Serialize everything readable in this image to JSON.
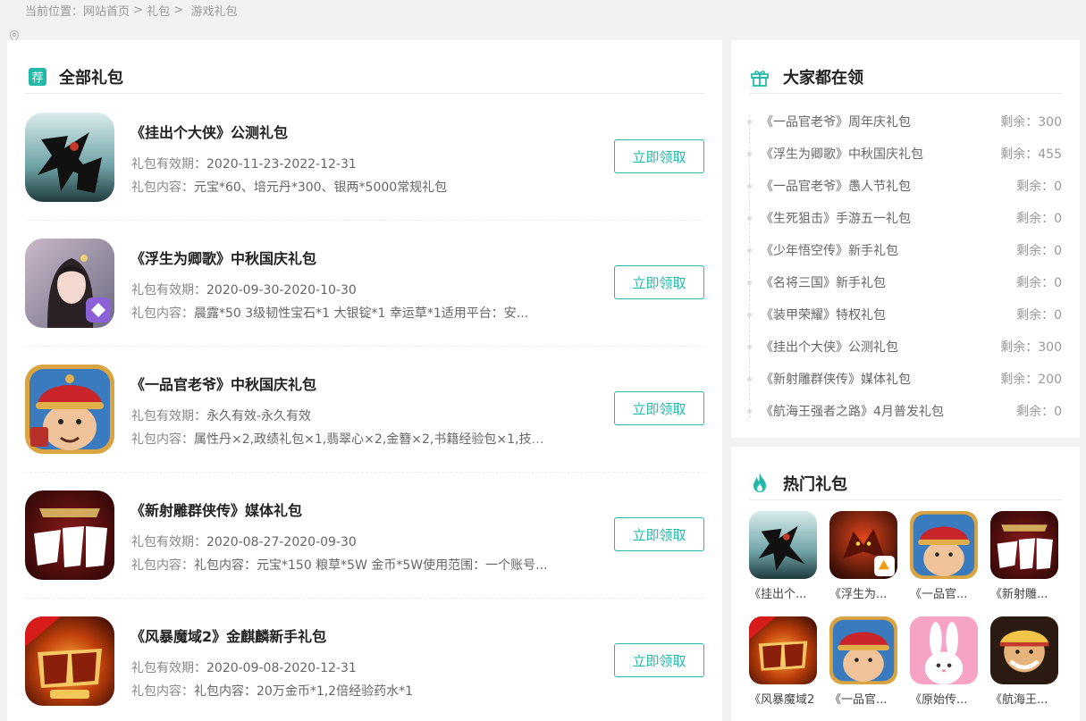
{
  "breadcrumb": {
    "prefix": "当前位置：",
    "home": "网站首页",
    "sep1": " > ",
    "gift": "礼包",
    "sep2": " >  ",
    "current": "游戏礼包"
  },
  "main": {
    "badge": "荐",
    "title": "全部礼包",
    "validity_label": "礼包有效期：",
    "content_label": "礼包内容：",
    "button_label": "立即领取",
    "gifts": [
      {
        "name": "《挂出个大侠》公测礼包",
        "validity": "2020-11-23-2022-12-31",
        "content": "元宝*60、培元丹*300、银两*5000常规礼包"
      },
      {
        "name": "《浮生为卿歌》中秋国庆礼包",
        "validity": "2020-09-30-2020-10-30",
        "content": "晨露*50    3级韧性宝石*1    大银锭*1 幸运草*1适用平台：安..."
      },
      {
        "name": "《一品官老爷》中秋国庆礼包",
        "validity": "永久有效-永久有效",
        "content": "属性丹×2,政绩礼包×1,翡翠心×2,金簪×2,书籍经验包×1,技能..."
      },
      {
        "name": "《新射雕群侠传》媒体礼包",
        "validity": "2020-08-27-2020-09-30",
        "content": "礼包内容：元宝*150 粮草*5W 金币*5W使用范围：一个账号..."
      },
      {
        "name": "《风暴魔域2》金麒麟新手礼包",
        "validity": "2020-09-08-2020-12-31",
        "content": "礼包内容：20万金币*1,2倍经验药水*1"
      }
    ]
  },
  "popular": {
    "title": "大家都在领",
    "remain_label": "剩余：",
    "items": [
      {
        "name": "《一品官老爷》周年庆礼包",
        "remain": "300"
      },
      {
        "name": "《浮生为卿歌》中秋国庆礼包",
        "remain": "455"
      },
      {
        "name": " 《一品官老爷》愚人节礼包",
        "remain": "0"
      },
      {
        "name": " 《生死狙击》手游五一礼包",
        "remain": "0"
      },
      {
        "name": " 《少年悟空传》新手礼包",
        "remain": "0"
      },
      {
        "name": " 《名将三国》新手礼包",
        "remain": "0"
      },
      {
        "name": " 《装甲荣耀》特权礼包",
        "remain": "0"
      },
      {
        "name": "《挂出个大侠》公测礼包",
        "remain": "300"
      },
      {
        "name": "《新射雕群侠传》媒体礼包",
        "remain": "200"
      },
      {
        "name": " 《航海王强者之路》4月普发礼包",
        "remain": "0"
      }
    ]
  },
  "hot": {
    "title": "热门礼包",
    "items": [
      {
        "name": "《挂出个..."
      },
      {
        "name": "《浮生为..."
      },
      {
        "name": "《一品官..."
      },
      {
        "name": "《新射雕..."
      },
      {
        "name": "《风暴魔域2"
      },
      {
        "name": "《一品官..."
      },
      {
        "name": "《原始传..."
      },
      {
        "name": "《航海王..."
      }
    ]
  },
  "icons": {
    "location": "location-pin-icon",
    "gift": "gift-box-icon",
    "fire": "fire-icon"
  },
  "colors": {
    "accent": "#22b9a8",
    "background": "#f2f2f2"
  }
}
